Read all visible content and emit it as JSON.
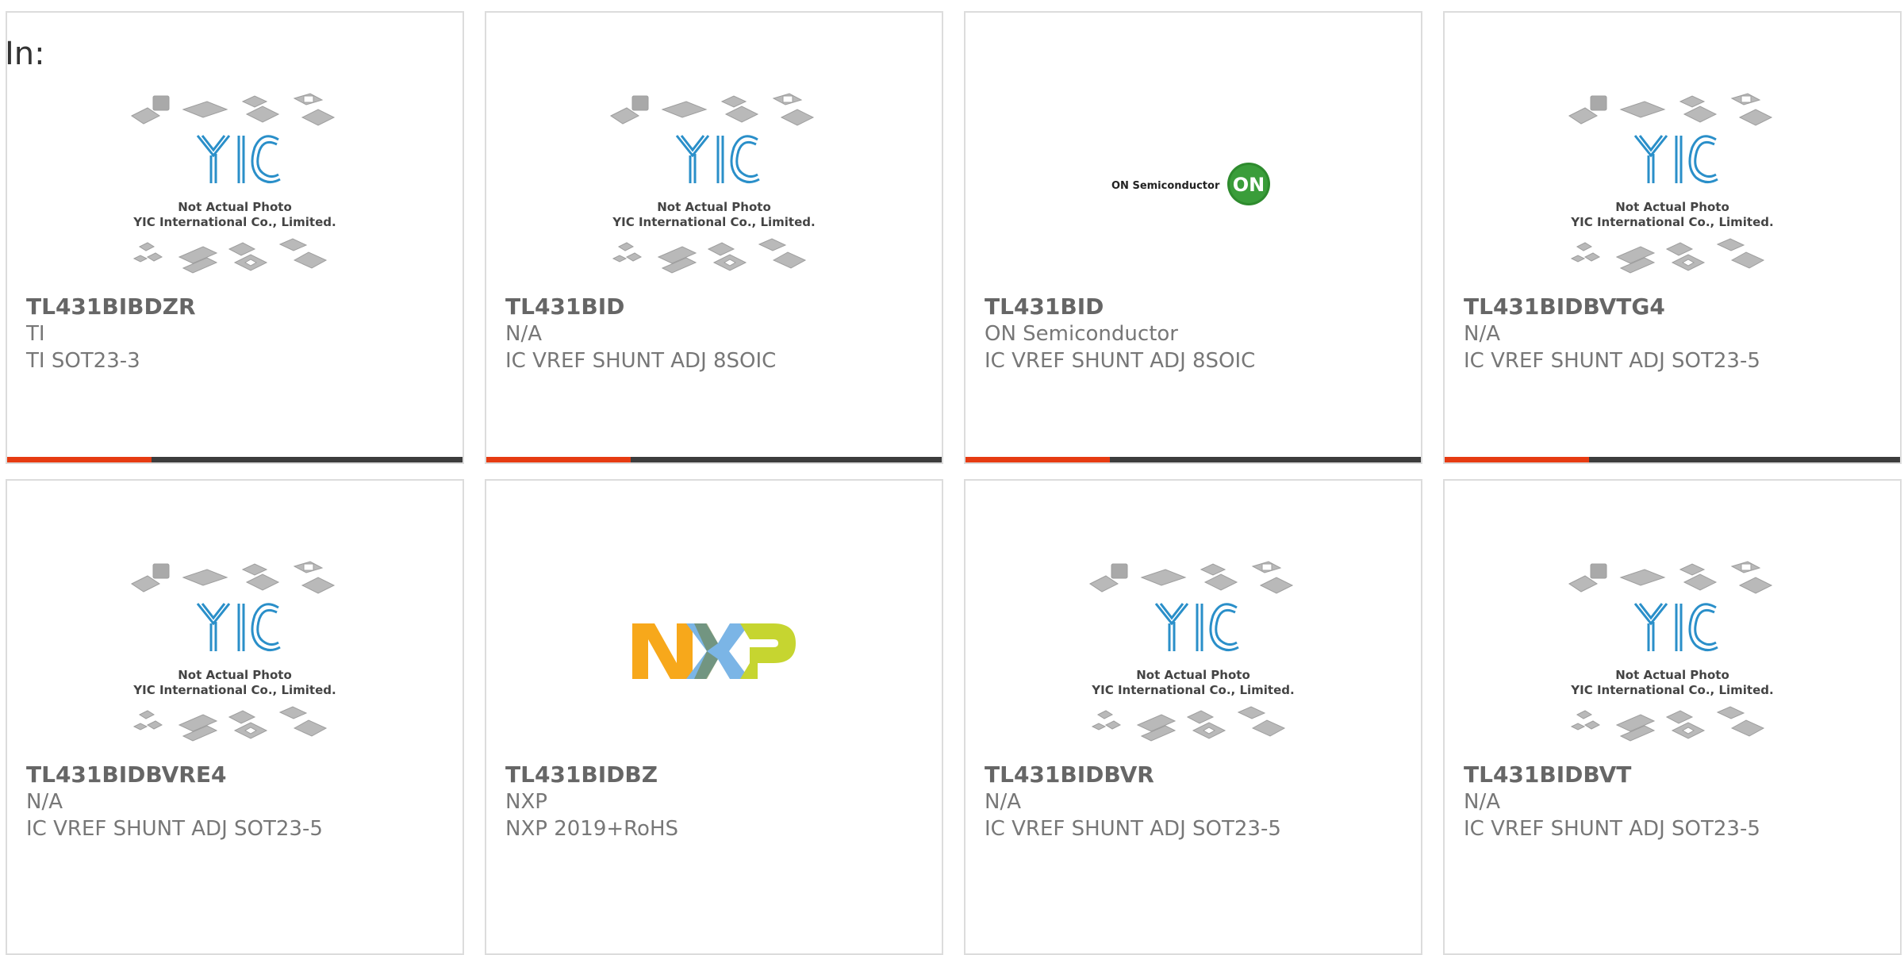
{
  "in_label": "In:",
  "placeholder": {
    "caption_line1": "Not Actual Photo",
    "caption_line2": "YIC International Co., Limited.",
    "logo_text": "YIC"
  },
  "logos": {
    "on": {
      "brand": "ON Semiconductor",
      "mark": "ON"
    },
    "nxp": {
      "letters": [
        "N",
        "X",
        "P"
      ],
      "colors": [
        "#f7a81b",
        "#7bb5e6",
        "#c6d530"
      ]
    }
  },
  "colors": {
    "accent": "#e63b12",
    "bar": "#3d3d3d",
    "yic_blue": "#2a8fc9",
    "on_green": "#2e8b2e"
  },
  "products": [
    {
      "part": "TL431BIBDZR",
      "maker": "TI",
      "desc": "TI SOT23-3",
      "image": "yic-placeholder"
    },
    {
      "part": "TL431BID",
      "maker": "N/A",
      "desc": "IC VREF SHUNT ADJ 8SOIC",
      "image": "yic-placeholder"
    },
    {
      "part": "TL431BID",
      "maker": "ON Semiconductor",
      "desc": "IC VREF SHUNT ADJ 8SOIC",
      "image": "on-semi-logo"
    },
    {
      "part": "TL431BIDBVTG4",
      "maker": "N/A",
      "desc": "IC VREF SHUNT ADJ SOT23-5",
      "image": "yic-placeholder"
    },
    {
      "part": "TL431BIDBVRE4",
      "maker": "N/A",
      "desc": "IC VREF SHUNT ADJ SOT23-5",
      "image": "yic-placeholder"
    },
    {
      "part": "TL431BIDBZ",
      "maker": "NXP",
      "desc": "NXP 2019+RoHS",
      "image": "nxp-logo"
    },
    {
      "part": "TL431BIDBVR",
      "maker": "N/A",
      "desc": "IC VREF SHUNT ADJ SOT23-5",
      "image": "yic-placeholder"
    },
    {
      "part": "TL431BIDBVT",
      "maker": "N/A",
      "desc": "IC VREF SHUNT ADJ SOT23-5",
      "image": "yic-placeholder"
    }
  ]
}
